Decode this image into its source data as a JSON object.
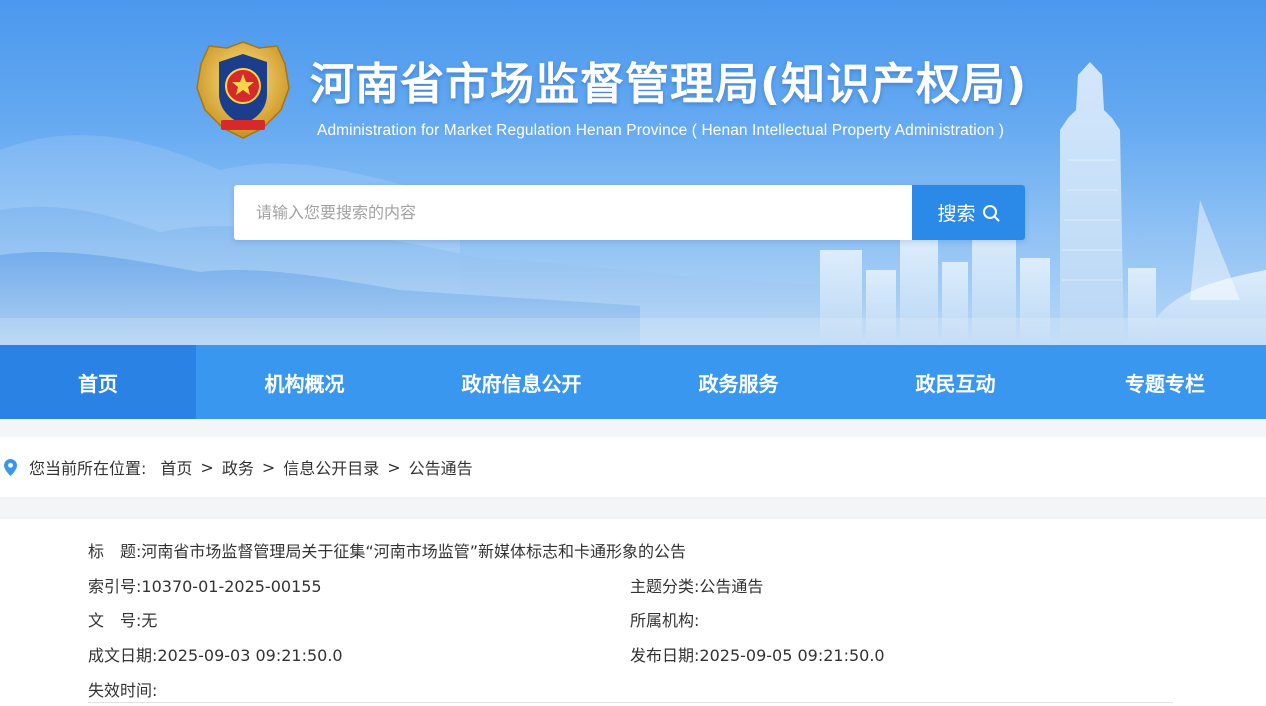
{
  "header": {
    "site_title": "河南省市场监督管理局(知识产权局)",
    "site_subtitle": "Administration for  Market Regulation Henan Province ( Henan Intellectual Property  Administration )",
    "emblem_icon": "police-emblem-icon"
  },
  "search": {
    "placeholder": "请输入您要搜索的内容",
    "button_label": "搜索"
  },
  "nav": {
    "items": [
      {
        "label": "首页",
        "active": true
      },
      {
        "label": "机构概况"
      },
      {
        "label": "政府信息公开"
      },
      {
        "label": "政务服务"
      },
      {
        "label": "政民互动"
      },
      {
        "label": "专题专栏"
      }
    ]
  },
  "breadcrumb": {
    "prefix": "您当前所在位置:",
    "items": [
      "首页",
      "政务",
      "信息公开目录",
      "公告通告"
    ],
    "separator": ">"
  },
  "meta": {
    "title_label": "标　题:",
    "title_value": "河南省市场监督管理局关于征集“河南市场监管”新媒体标志和卡通形象的公告",
    "index_label": "索引号:",
    "index_value": "10370-01-2025-00155",
    "category_label": "主题分类:",
    "category_value": "公告通告",
    "docno_label": "文　号:",
    "docno_value": "无",
    "org_label": "所属机构:",
    "org_value": "",
    "created_label": "成文日期:",
    "created_value": "2025-09-03 09:21:50.0",
    "published_label": "发布日期:",
    "published_value": "2025-09-05 09:21:50.0",
    "expiry_label": "失效时间:",
    "expiry_value": ""
  },
  "colors": {
    "nav_bg": "#3a97f0",
    "nav_active": "#2a83e4",
    "search_button": "#2b8ae8"
  }
}
